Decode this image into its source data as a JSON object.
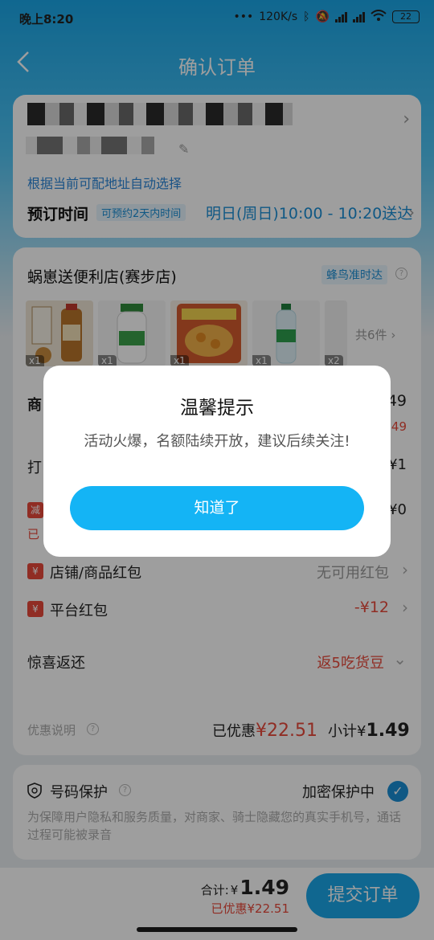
{
  "status_bar": {
    "time": "晚上8:20",
    "network_speed": "120K/s",
    "battery": "22"
  },
  "header": {
    "title": "确认订单"
  },
  "address": {
    "auto_hint": "根据当前可配地址自动选择",
    "schedule_label": "预订时间",
    "schedule_tag": "可预约2天内时间",
    "schedule_value": "明日(周日)10:00 - 10:20送达"
  },
  "order": {
    "shop_name": "蜗崽送便利店(赛步店)",
    "delivery_badge": "蜂鸟准时达",
    "items": [
      {
        "qty": "x1",
        "icon": "tea-bottle-icon"
      },
      {
        "qty": "x1",
        "icon": "milk-bottle-icon"
      },
      {
        "qty": "x1",
        "icon": "snack-bag-icon"
      },
      {
        "qty": "x1",
        "icon": "water-bottle-icon"
      },
      {
        "qty": "x2",
        "icon": "product-icon"
      }
    ],
    "total_items": "共6件",
    "row_goods_label": "商",
    "row_goods_value": "49",
    "row_goods_sub": ".49",
    "row_pack_label": "打",
    "row_pack_value": "¥1",
    "row_discount_icon": "减",
    "row_discount_value": "¥0",
    "row_discount_sub": "已",
    "shop_redpacket_label": "店铺/商品红包",
    "shop_redpacket_value": "无可用红包",
    "platform_redpacket_label": "平台红包",
    "platform_redpacket_value": "-¥12",
    "surprise_label": "惊喜返还",
    "surprise_value": "返5吃货豆",
    "summary_label": "优惠说明",
    "summary_discount_label": "已优惠",
    "summary_discount_value": "¥22.51",
    "summary_subtotal_label": "小计¥",
    "summary_subtotal_value": "1.49",
    "redpacket_icon_text": "¥"
  },
  "phone_protection": {
    "label": "号码保护",
    "status": "加密保护中",
    "description": "为保障用户隐私和服务质量，对商家、骑士隐藏您的真实手机号，通话过程可能被录音"
  },
  "bottom_bar": {
    "total_label": "合计:",
    "currency": "¥",
    "total_value": "1.49",
    "discount_text": "已优惠¥22.51",
    "submit_label": "提交订单"
  },
  "dialog": {
    "title": "温馨提示",
    "message": "活动火爆，名额陆续开放，建议后续关注!",
    "button_label": "知道了"
  },
  "colors": {
    "accent": "#1aa7e8",
    "dialog_button": "#14b4f5",
    "link_blue": "#1a8fd6",
    "red": "#e84a3b"
  }
}
